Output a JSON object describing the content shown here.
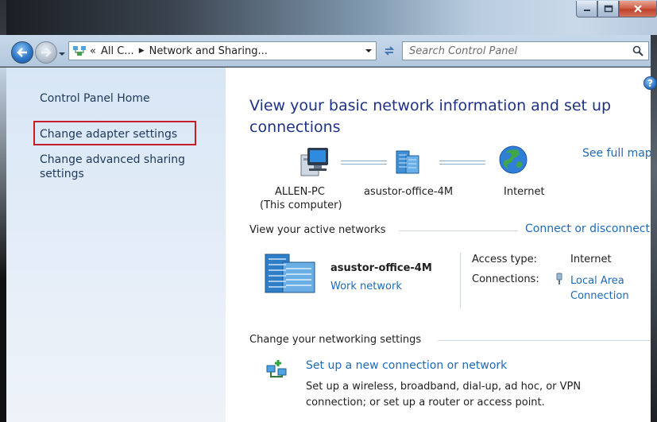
{
  "window": {
    "minimize_label": "minimize",
    "maximize_label": "maximize",
    "close_label": "close"
  },
  "address": {
    "overflow": "«",
    "crumbs": [
      "All C...",
      "Network and Sharing..."
    ],
    "search_placeholder": "Search Control Panel"
  },
  "sidebar": {
    "home": "Control Panel Home",
    "items": [
      {
        "label": "Change adapter settings",
        "highlighted": true
      },
      {
        "label": "Change advanced sharing settings",
        "highlighted": false
      }
    ]
  },
  "help_label": "?",
  "main": {
    "heading": "View your basic network information and set up connections",
    "see_full_map": "See full map",
    "map": {
      "computer_name": "ALLEN-PC",
      "computer_sub": "(This computer)",
      "network_name": "asustor-office-4M",
      "internet_name": "Internet"
    },
    "active_networks": {
      "title": "View your active networks",
      "connect_link": "Connect or disconnect",
      "network_name": "asustor-office-4M",
      "network_type": "Work network",
      "access_type_label": "Access type:",
      "access_type_value": "Internet",
      "connections_label": "Connections:",
      "connections_value": "Local Area Connection"
    },
    "change_settings": {
      "title": "Change your networking settings",
      "setup_link": "Set up a new connection or network",
      "setup_desc": "Set up a wireless, broadband, dial-up, ad hoc, or VPN connection; or set up a router or access point."
    }
  },
  "colors": {
    "link": "#1e6ab8",
    "heading": "#1e3287",
    "highlight": "#c41f26"
  }
}
